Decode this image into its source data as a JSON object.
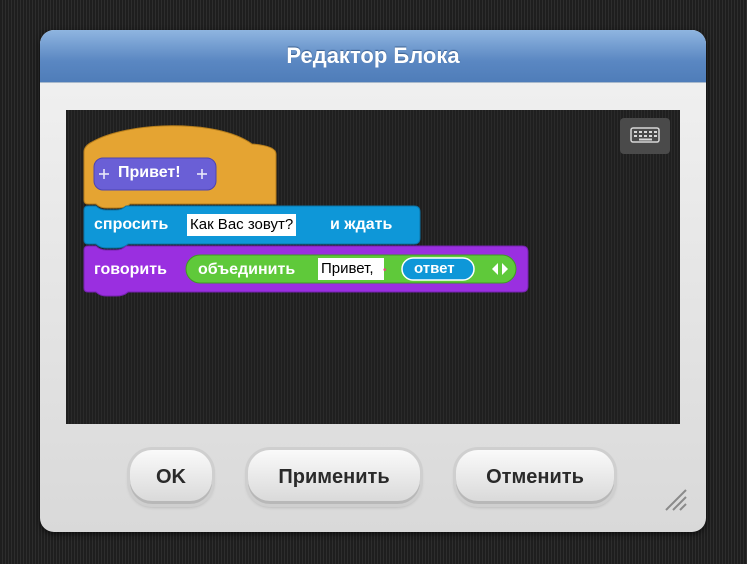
{
  "dialog": {
    "title": "Редактор Блока"
  },
  "blocks": {
    "hat": {
      "label": "Привет!"
    },
    "ask": {
      "label": "спросить",
      "input": "Как Вас зовут?",
      "suffix": "и ждать"
    },
    "say": {
      "label": "говорить",
      "join_label": "объединить",
      "input": "Привет,",
      "reporter": "ответ"
    }
  },
  "buttons": {
    "ok": "OK",
    "apply": "Применить",
    "cancel": "Отменить"
  },
  "colors": {
    "hat": "#e5a432",
    "custom_block": "#6a5fd6",
    "sensing": "#0e97d8",
    "looks": "#9a2fe0",
    "operators": "#5fc93a"
  },
  "icons": {
    "keyboard": "keyboard-icon",
    "resize": "resize-grip-icon"
  }
}
